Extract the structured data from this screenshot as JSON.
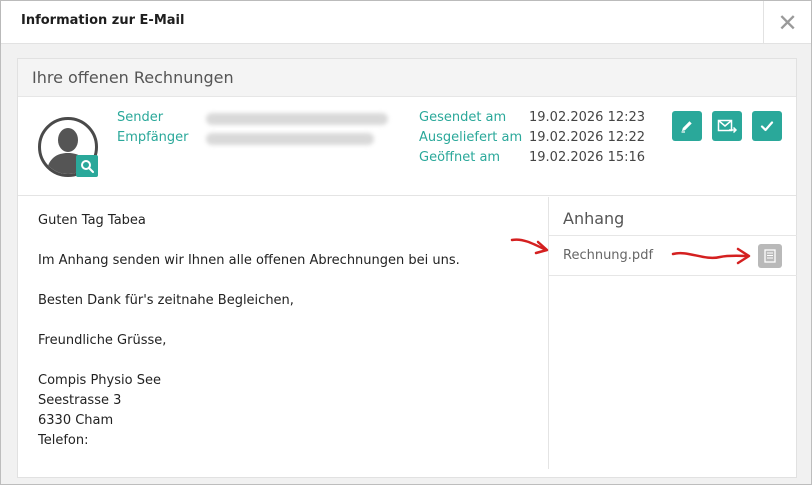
{
  "modal": {
    "title": "Information zur E-Mail",
    "close_glyph": "✕"
  },
  "card": {
    "title": "Ihre offenen Rechnungen"
  },
  "meta": {
    "sender_label": "Sender",
    "recipient_label": "Empfänger",
    "sent_label": "Gesendet am",
    "sent_value": "19.02.2026 12:23",
    "delivered_label": "Ausgeliefert am",
    "delivered_value": "19.02.2026 12:22",
    "opened_label": "Geöffnet am",
    "opened_value": "19.02.2026 15:16"
  },
  "actions": [
    {
      "name": "edit",
      "icon": "pencil-icon"
    },
    {
      "name": "forward",
      "icon": "mail-forward-icon"
    },
    {
      "name": "confirm",
      "icon": "check-icon"
    }
  ],
  "body_lines": [
    "Guten Tag Tabea",
    "Im Anhang senden wir Ihnen alle offenen Abrechnungen bei uns.",
    "Besten Dank für's zeitnahe Begleichen,",
    "Freundliche Grüsse,",
    "Compis Physio See",
    "Seestrasse 3",
    "6330 Cham",
    "Telefon:"
  ],
  "attachments": {
    "title": "Anhang",
    "items": [
      {
        "name": "Rechnung.pdf",
        "icon": "document-icon"
      }
    ]
  },
  "colors": {
    "accent": "#2aa89a",
    "annotation": "#d42020",
    "file_button": "#b9b9b9"
  }
}
